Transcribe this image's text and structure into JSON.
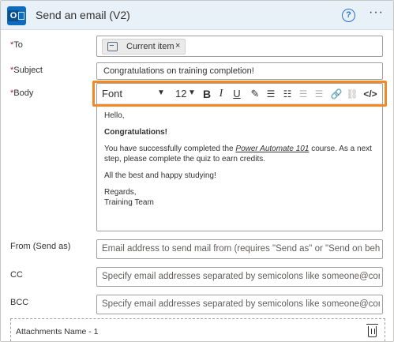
{
  "header": {
    "title": "Send an email (V2)",
    "help_symbol": "?",
    "more_symbol": "···",
    "brand_color": "#0f6cbd"
  },
  "fields": {
    "to": {
      "label": "To",
      "token": "Current item",
      "token_remove": "×"
    },
    "subject": {
      "label": "Subject",
      "value": "Congratulations on training completion!"
    },
    "body": {
      "label": "Body",
      "toolbar": {
        "font": "Font",
        "size": "12",
        "bold": "B",
        "italic": "I",
        "underline": "U",
        "highlight_color": "#f08a24"
      },
      "content": {
        "greeting": "Hello,",
        "headline": "Congratulations!",
        "line1_before": "You have successfully completed the ",
        "course_link": "Power Automate 101",
        "line1_after": " course. As a next step, please complete the quiz to earn credits.",
        "line2": "All the best and happy studying!",
        "signoff": "Regards,",
        "signature": "Training Team"
      }
    },
    "from": {
      "label": "From (Send as)",
      "placeholder": "Email address to send mail from (requires \"Send as\" or \"Send on beh."
    },
    "cc": {
      "label": "CC",
      "placeholder": "Specify email addresses separated by semicolons like someone@con"
    },
    "bcc": {
      "label": "BCC",
      "placeholder": "Specify email addresses separated by semicolons like someone@con"
    },
    "attachments": {
      "label": "Attachments Name - 1"
    }
  },
  "required_marker": "*"
}
